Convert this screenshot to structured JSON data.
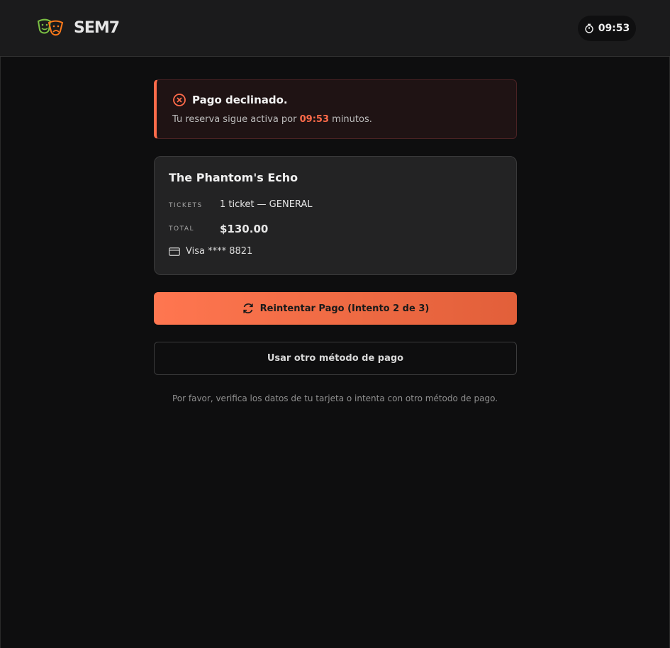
{
  "header": {
    "brand": "SEM7",
    "logo_icon": "theater-masks-icon",
    "timer": "09:53"
  },
  "alert": {
    "title": "Pago declinado.",
    "message_prefix": "Tu reserva sigue activa por",
    "time": "09:53",
    "message_suffix": "minutos."
  },
  "order": {
    "title": "The Phantom's Echo",
    "tickets_label": "TICKETS",
    "tickets_value": "1 ticket — GENERAL",
    "total_label": "TOTAL",
    "total_value": "$130.00",
    "payment_method": "Visa **** 8821"
  },
  "actions": {
    "retry_label": "Reintentar Pago (Intento 2 de 3)",
    "alternate_label": "Usar otro método de pago"
  },
  "help_text": "Por favor, verifica los datos de tu tarjeta o intenta con otro método de pago.",
  "colors": {
    "accent": "#ff6b4a",
    "background": "#0e0e0f",
    "header_bg": "#1b1b1c"
  }
}
